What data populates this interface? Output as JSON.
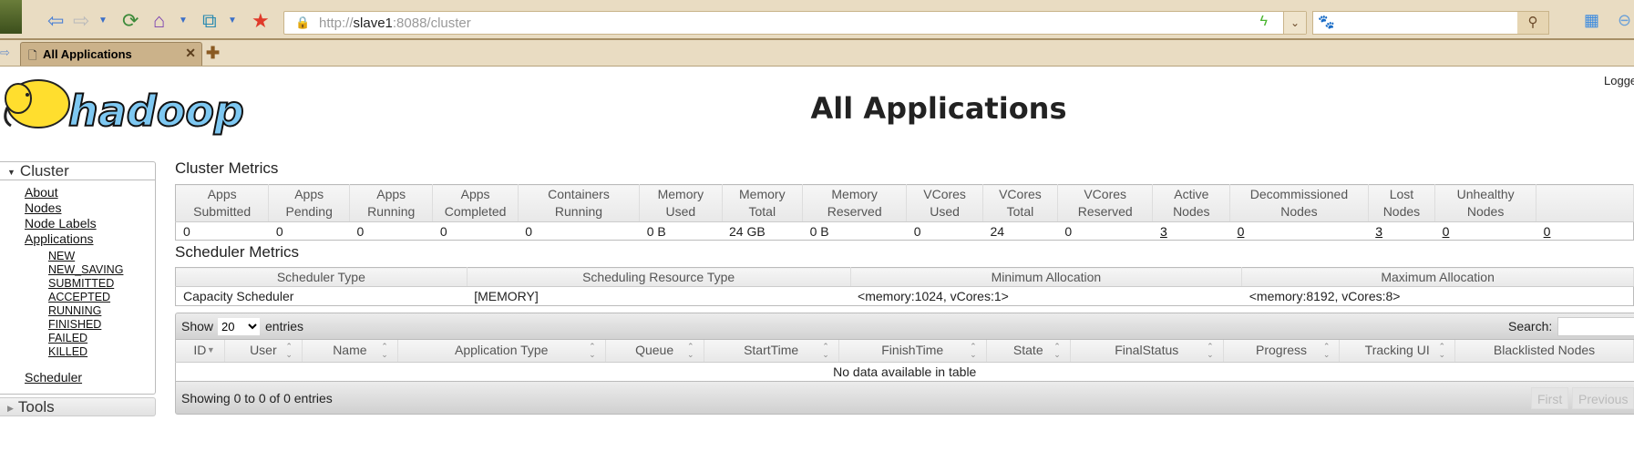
{
  "browser": {
    "url_prefix": "http://",
    "url_host": "slave1",
    "url_rest": ":8088/cluster",
    "tab_title": "All Applications",
    "icons": [
      "back-icon",
      "forward-icon",
      "refresh-icon",
      "home-icon",
      "restore-icon",
      "favorite-star-icon",
      "lock-error-icon",
      "bolt-icon",
      "search-icon"
    ]
  },
  "header": {
    "title": "All Applications",
    "logged_in": "Logged in as: dr.who",
    "logo_text": "hadoop"
  },
  "sidebar": {
    "cluster": "Cluster",
    "items": [
      "About",
      "Nodes",
      "Node Labels",
      "Applications"
    ],
    "app_states": [
      "NEW",
      "NEW_SAVING",
      "SUBMITTED",
      "ACCEPTED",
      "RUNNING",
      "FINISHED",
      "FAILED",
      "KILLED"
    ],
    "scheduler": "Scheduler",
    "tools": "Tools"
  },
  "cluster_metrics": {
    "title": "Cluster Metrics",
    "headers": [
      [
        "Apps",
        "Submitted"
      ],
      [
        "Apps",
        "Pending"
      ],
      [
        "Apps",
        "Running"
      ],
      [
        "Apps",
        "Completed"
      ],
      [
        "Containers",
        "Running"
      ],
      [
        "Memory",
        "Used"
      ],
      [
        "Memory",
        "Total"
      ],
      [
        "Memory",
        "Reserved"
      ],
      [
        "VCores",
        "Used"
      ],
      [
        "VCores",
        "Total"
      ],
      [
        "VCores",
        "Reserved"
      ],
      [
        "Active",
        "Nodes"
      ],
      [
        "Decommissioned",
        "Nodes"
      ],
      [
        "Lost",
        "Nodes"
      ],
      [
        "Unhealthy",
        "Nodes"
      ],
      [
        "",
        ""
      ]
    ],
    "values": [
      "0",
      "0",
      "0",
      "0",
      "0",
      "0 B",
      "24 GB",
      "0 B",
      "0",
      "24",
      "0",
      "3",
      "0",
      "3",
      "0",
      "0"
    ]
  },
  "scheduler_metrics": {
    "title": "Scheduler Metrics",
    "headers": [
      "Scheduler Type",
      "Scheduling Resource Type",
      "Minimum Allocation",
      "Maximum Allocation"
    ],
    "values": [
      "Capacity Scheduler",
      "[MEMORY]",
      "<memory:1024, vCores:1>",
      "<memory:8192, vCores:8>"
    ]
  },
  "apps_table": {
    "show_label": "Show",
    "page_size": "20",
    "entries_label": "entries",
    "search_label": "Search:",
    "search_value": "",
    "headers": [
      "ID",
      "User",
      "Name",
      "Application Type",
      "Queue",
      "StartTime",
      "FinishTime",
      "State",
      "FinalStatus",
      "Progress",
      "Tracking UI",
      "Blacklisted Nodes"
    ],
    "empty": "No data available in table",
    "info": "Showing 0 to 0 of 0 entries",
    "first": "First",
    "previous": "Previous"
  }
}
